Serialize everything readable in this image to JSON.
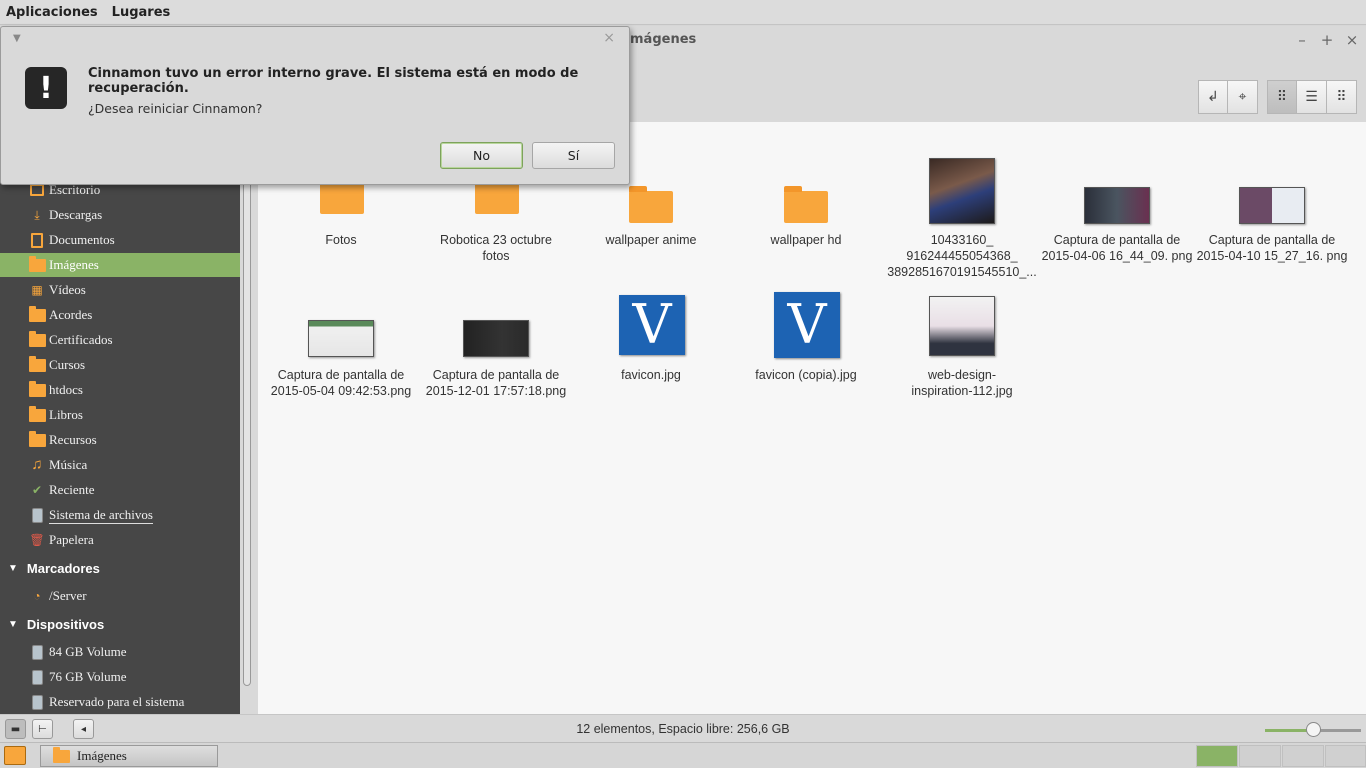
{
  "top_panel": {
    "menus": [
      "Aplicaciones",
      "Lugares"
    ]
  },
  "window": {
    "title_fragment": "mágenes",
    "controls": {
      "minimize": "–",
      "maximize": "+",
      "close": "×"
    }
  },
  "sidebar": {
    "items": [
      {
        "label": "Escritorio",
        "icon": "desktop-icon"
      },
      {
        "label": "Descargas",
        "icon": "download-icon"
      },
      {
        "label": "Documentos",
        "icon": "document-icon"
      },
      {
        "label": "Imágenes",
        "icon": "folder-icon",
        "selected": true
      },
      {
        "label": "Vídeos",
        "icon": "video-icon"
      },
      {
        "label": "Acordes",
        "icon": "folder-icon"
      },
      {
        "label": "Certificados",
        "icon": "folder-icon"
      },
      {
        "label": "Cursos",
        "icon": "folder-icon"
      },
      {
        "label": "htdocs",
        "icon": "folder-icon"
      },
      {
        "label": "Libros",
        "icon": "folder-icon"
      },
      {
        "label": "Recursos",
        "icon": "folder-icon"
      },
      {
        "label": "Música",
        "icon": "music-icon"
      },
      {
        "label": "Reciente",
        "icon": "recent-icon"
      },
      {
        "label": "Sistema de archivos",
        "icon": "drive-icon"
      },
      {
        "label": "Papelera",
        "icon": "trash-icon"
      }
    ],
    "bookmarks_header": "Marcadores",
    "bookmarks": [
      {
        "label": "/Server",
        "icon": "server-icon"
      }
    ],
    "devices_header": "Dispositivos",
    "devices": [
      {
        "label": "84 GB Volume",
        "icon": "drive-icon"
      },
      {
        "label": "76 GB Volume",
        "icon": "drive-icon"
      },
      {
        "label": "Reservado para el sistema",
        "icon": "drive-icon"
      }
    ]
  },
  "files": [
    {
      "name": "Fotos",
      "kind": "folder"
    },
    {
      "name": "Robotica 23 octubre fotos",
      "kind": "folder"
    },
    {
      "name": "wallpaper anime",
      "kind": "folder"
    },
    {
      "name": "wallpaper hd",
      "kind": "folder"
    },
    {
      "name": "10433160_ 916244455054368_ 3892851670191545510_...",
      "kind": "photo"
    },
    {
      "name": "Captura de pantalla de 2015-04-06 16_44_09. png",
      "kind": "screenshot"
    },
    {
      "name": "Captura de pantalla de 2015-04-10 15_27_16. png",
      "kind": "screenshot"
    },
    {
      "name": "Captura de pantalla de 2015-05-04 09:42:53.png",
      "kind": "screenshot"
    },
    {
      "name": "Captura de pantalla de 2015-12-01 17:57:18.png",
      "kind": "screenshot"
    },
    {
      "name": "favicon.jpg",
      "kind": "favicon",
      "glyph": "V"
    },
    {
      "name": "favicon (copia).jpg",
      "kind": "favicon",
      "glyph": "V"
    },
    {
      "name": "web-design- inspiration-112.jpg",
      "kind": "web-image"
    }
  ],
  "statusbar": {
    "text": "12 elementos, Espacio libre: 256,6 GB",
    "zoom_level": 0.5
  },
  "taskbar": {
    "task_label": "Imágenes"
  },
  "dialog": {
    "title": "Cinnamon tuvo un error interno grave. El sistema está en modo de recuperación.",
    "message": "¿Desea reiniciar Cinnamon?",
    "no_label": "No",
    "yes_label": "Sí",
    "close_glyph": "×",
    "warning_glyph": "!"
  },
  "colors": {
    "accent": "#8ab366",
    "folder": "#f8a63c",
    "sidebar_bg": "#474747",
    "favicon_blue": "#1d63b3"
  }
}
